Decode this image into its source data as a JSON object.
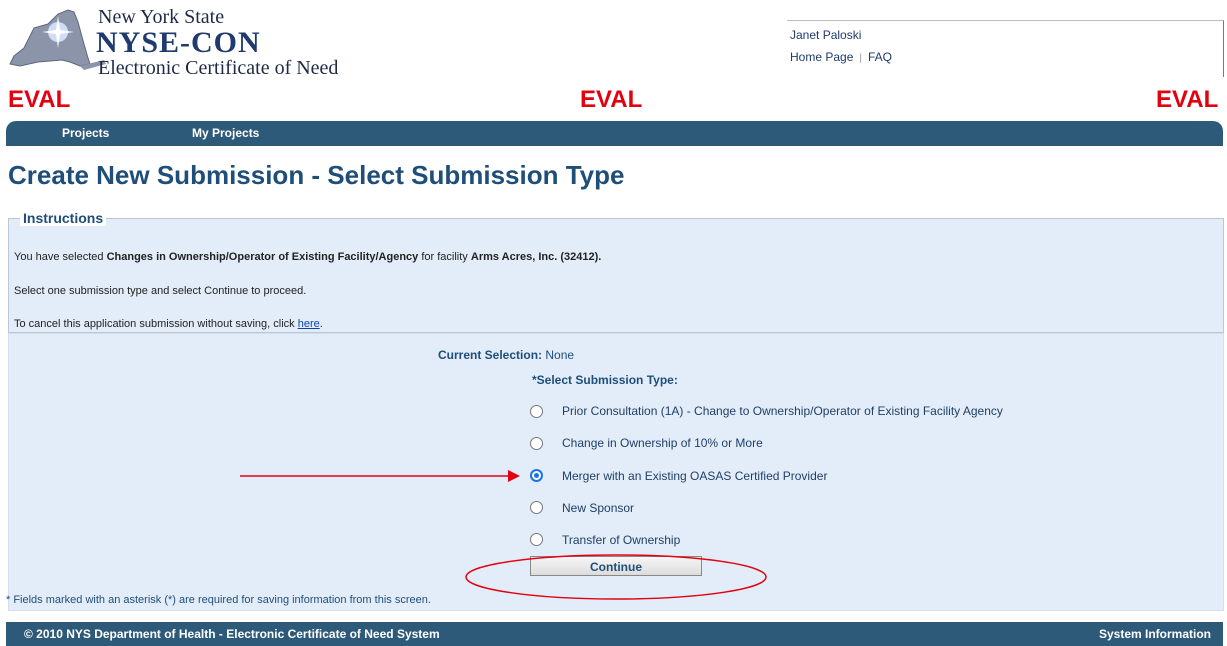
{
  "header": {
    "logo_line1": "New York State",
    "logo_line2": "NYSE-CON",
    "logo_line3": "Electronic Certificate of Need",
    "user_name": "Janet Paloski",
    "links": [
      "Home Page",
      "FAQ"
    ],
    "watermark": "EVAL"
  },
  "nav": {
    "items": [
      "Projects",
      "My Projects"
    ]
  },
  "page_title": "Create New Submission - Select Submission Type",
  "instructions": {
    "legend": "Instructions",
    "line1_prefix": "You have selected ",
    "line1_type": "Changes in Ownership/Operator of Existing Facility/Agency",
    "line1_mid": " for facility ",
    "line1_facility": "Arms Acres, Inc. (32412).",
    "line2": "Select one submission type and select Continue to proceed.",
    "line3_prefix": "To cancel this application submission without saving, click ",
    "line3_link": "here",
    "line3_suffix": "."
  },
  "form": {
    "current_selection_label": "Current Selection:",
    "current_selection_value": "None",
    "select_label": "*Select Submission Type:",
    "options": [
      {
        "label": "Prior Consultation (1A) - Change to Ownership/Operator of Existing Facility Agency",
        "checked": false
      },
      {
        "label": "Change in Ownership of 10% or More",
        "checked": false
      },
      {
        "label": "Merger with an Existing OASAS Certified Provider",
        "checked": true
      },
      {
        "label": "New Sponsor",
        "checked": false
      },
      {
        "label": "Transfer of Ownership",
        "checked": false
      }
    ],
    "continue_label": "Continue",
    "footnote": "* Fields marked with an asterisk (*) are required for saving information from this screen."
  },
  "footer": {
    "copyright": "© 2010 NYS Department of Health - Electronic Certificate of Need System",
    "system_info": "System Information"
  },
  "colors": {
    "annotation": "#e3000f",
    "brand_blue": "#1f4e79",
    "nav_bg": "#2e5a7a",
    "panel_bg": "#e3edf9"
  }
}
